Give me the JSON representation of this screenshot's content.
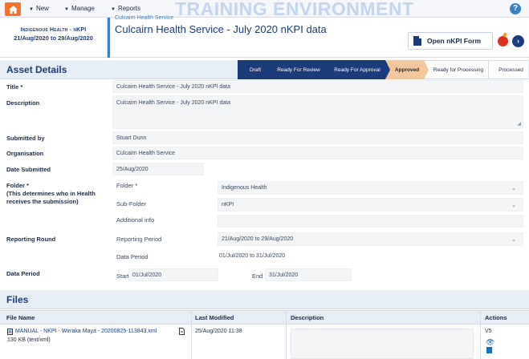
{
  "topnav": {
    "new_label": "New",
    "manage_label": "Manage",
    "reports_label": "Reports",
    "env_banner": "TRAINING ENVIRONMENT",
    "help_glyph": "?"
  },
  "header": {
    "org_context": "Indigenous Health - nKPI",
    "date_range": "21/Aug/2020 to 29/Aug/2020",
    "service_name": "Culcairn Health Service",
    "asset_title": "Culcairn Health Service - July 2020 nKPI data",
    "open_form_label": "Open nKPI Form",
    "next_glyph": "›"
  },
  "asset_details": {
    "section_title": "Asset Details",
    "workflow": [
      {
        "label": "Draft",
        "state": "done"
      },
      {
        "label": "Ready For Review",
        "state": "done"
      },
      {
        "label": "Ready For Approval",
        "state": "done"
      },
      {
        "label": "Approved",
        "state": "current"
      },
      {
        "label": "Ready for Processing",
        "state": "todo"
      },
      {
        "label": "Processed",
        "state": "todo"
      }
    ]
  },
  "form": {
    "title_label": "Title *",
    "title_value": "Culcairn Health Service - July 2020 nKPI data",
    "description_label": "Description",
    "description_value": "Culcairn Health Service - July 2020 nKPI data",
    "submitted_by_label": "Submitted by",
    "submitted_by_value": "Stuart Dunn",
    "organisation_label": "Organisation",
    "organisation_value": "Culcairn Health Service",
    "date_submitted_label": "Date Submitted",
    "date_submitted_value": "25/Aug/2020",
    "folder_label": "Folder *",
    "folder_help": "(This determines who in Health receives the submission)",
    "folder_sub_label": "Folder *",
    "folder_value": "Indigenous Health",
    "subfolder_label": "Sub-Folder",
    "subfolder_value": "nKPI",
    "additional_info_label": "Additional info",
    "additional_info_value": "",
    "reporting_round_label": "Reporting Round",
    "reporting_period_label": "Reporting Period",
    "reporting_period_value": "21/Aug/2020 to 29/Aug/2020",
    "data_period_sub_label": "Data Period",
    "data_period_value": "01/Jul/2020 to 31/Jul/2020",
    "data_period_label": "Data Period",
    "start_label": "Start",
    "start_value": "01/Jul/2020",
    "end_label": "End",
    "end_value": "31/Jul/2020"
  },
  "files": {
    "section_title": "Files",
    "columns": [
      "File Name",
      "Last Modified",
      "Description",
      "Actions"
    ],
    "rows": [
      {
        "file_name": "MANUAL - NKPI - Wirraka Maya - 20200825-113843.xml",
        "file_size": "130 KB (text/xml)",
        "last_modified": "25/Aug/2020 11:38",
        "description": "",
        "version": "V5"
      }
    ]
  },
  "colors": {
    "accent_orange": "#f4722b",
    "brand_navy": "#1a3c78",
    "link_blue": "#3b7fc1",
    "approved_step": "#f3c79b"
  }
}
